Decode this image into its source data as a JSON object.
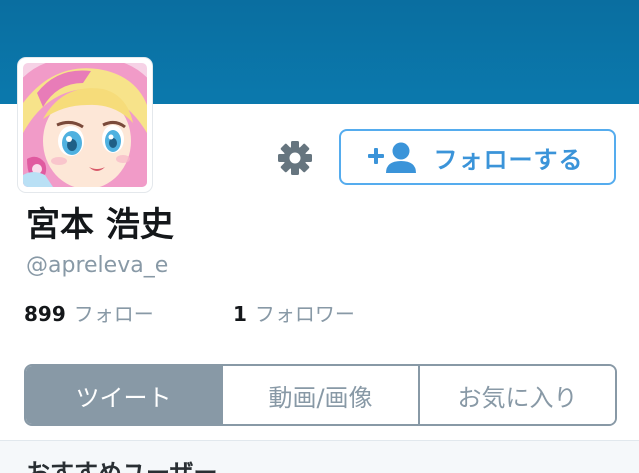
{
  "profile": {
    "display_name": "宮本 浩史",
    "screen_name": "@apreleva_e"
  },
  "actions": {
    "settings_icon": "gear-icon",
    "follow_icon": "add-user-icon",
    "follow_label": "フォローする"
  },
  "stats": {
    "following_count": "899",
    "following_label": "フォロー",
    "followers_count": "1",
    "followers_label": "フォロワー"
  },
  "tabs": [
    {
      "label": "ツイート",
      "active": true
    },
    {
      "label": "動画/画像",
      "active": false
    },
    {
      "label": "お気に入り",
      "active": false
    }
  ],
  "section": {
    "title": "おすすめユーザー"
  },
  "colors": {
    "header_blue": "#0b79ad",
    "accent_blue": "#55acee",
    "muted_gray": "#8899a6"
  }
}
